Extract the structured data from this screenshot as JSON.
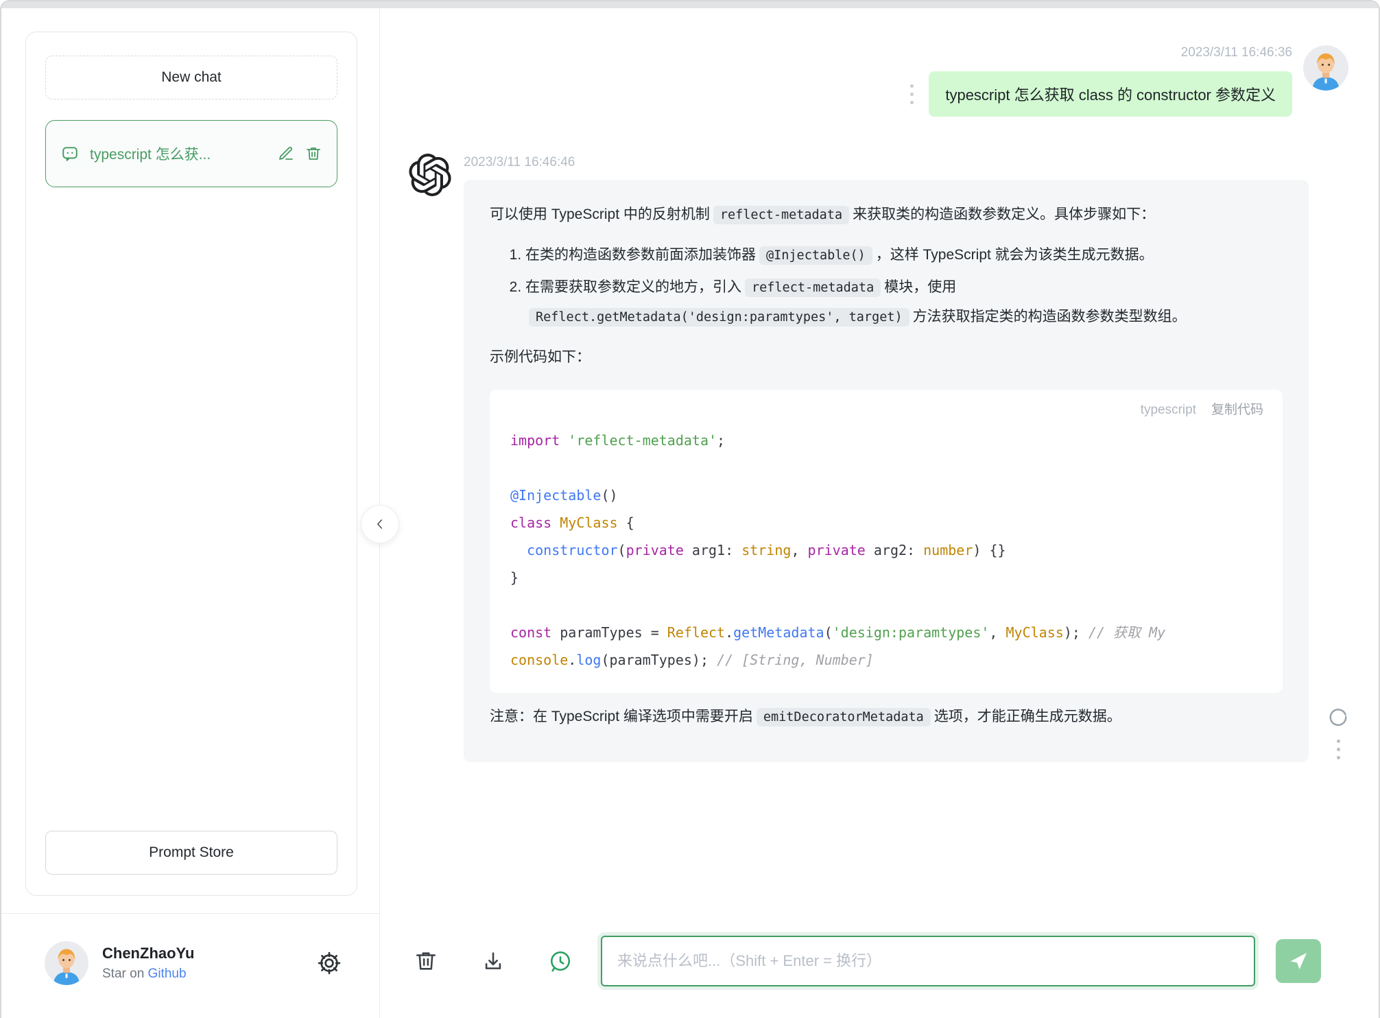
{
  "sidebar": {
    "new_chat_label": "New chat",
    "conversation": {
      "title": "typescript 怎么获..."
    },
    "prompt_store_label": "Prompt Store",
    "user": {
      "name": "ChenZhaoYu",
      "star_prefix": "Star on ",
      "github_label": "Github"
    }
  },
  "chat": {
    "user_message": {
      "timestamp": "2023/3/11 16:46:36",
      "text": "typescript 怎么获取 class 的 constructor 参数定义"
    },
    "assistant_message": {
      "timestamp": "2023/3/11 16:46:46",
      "intro": [
        {
          "t": "可以使用 TypeScript 中的反射机制"
        },
        {
          "t": "reflect-metadata",
          "code": true
        },
        {
          "t": "来获取类的构造函数参数定义。具体步骤如下："
        }
      ],
      "steps": [
        [
          {
            "t": "在类的构造函数参数前面添加装饰器"
          },
          {
            "t": "@Injectable()",
            "code": true
          },
          {
            "t": "，这样 TypeScript 就会为该类生成元数据。"
          }
        ],
        [
          {
            "t": "在需要获取参数定义的地方，引入"
          },
          {
            "t": "reflect-metadata",
            "code": true
          },
          {
            "t": "模块，使用"
          },
          {
            "t": "Reflect.getMetadata('design:paramtypes', target)",
            "code": true
          },
          {
            "t": "方法获取指定类的构造函数参数类型数组。"
          }
        ]
      ],
      "example_label": "示例代码如下：",
      "note": [
        {
          "t": "注意：在 TypeScript 编译选项中需要开启"
        },
        {
          "t": "emitDecoratorMetadata",
          "code": true
        },
        {
          "t": "选项，才能正确生成元数据。"
        }
      ]
    },
    "code_block": {
      "language": "typescript",
      "copy_label": "复制代码",
      "lines": [
        [
          {
            "t": "import",
            "c": "kw"
          },
          {
            "t": " "
          },
          {
            "t": "'reflect-metadata'",
            "c": "str"
          },
          {
            "t": ";"
          }
        ],
        [],
        [
          {
            "t": "@Injectable",
            "c": "meta"
          },
          {
            "t": "()"
          }
        ],
        [
          {
            "t": "class",
            "c": "kw"
          },
          {
            "t": " "
          },
          {
            "t": "MyClass",
            "c": "type"
          },
          {
            "t": " {"
          }
        ],
        [
          {
            "t": "  "
          },
          {
            "t": "constructor",
            "c": "fn"
          },
          {
            "t": "("
          },
          {
            "t": "private",
            "c": "kw"
          },
          {
            "t": " arg1: "
          },
          {
            "t": "string",
            "c": "type"
          },
          {
            "t": ", "
          },
          {
            "t": "private",
            "c": "kw"
          },
          {
            "t": " arg2: "
          },
          {
            "t": "number",
            "c": "type"
          },
          {
            "t": ") {}"
          }
        ],
        [
          {
            "t": "}"
          }
        ],
        [],
        [
          {
            "t": "const",
            "c": "kw"
          },
          {
            "t": " paramTypes = "
          },
          {
            "t": "Reflect",
            "c": "type"
          },
          {
            "t": "."
          },
          {
            "t": "getMetadata",
            "c": "fn"
          },
          {
            "t": "("
          },
          {
            "t": "'design:paramtypes'",
            "c": "str"
          },
          {
            "t": ", "
          },
          {
            "t": "MyClass",
            "c": "type"
          },
          {
            "t": "); "
          },
          {
            "t": "// 获取 My",
            "c": "cmt"
          }
        ],
        [
          {
            "t": "console",
            "c": "type"
          },
          {
            "t": "."
          },
          {
            "t": "log",
            "c": "fn"
          },
          {
            "t": "("
          },
          {
            "t": "paramTypes); "
          },
          {
            "t": "// [String, Number]",
            "c": "cmt"
          }
        ]
      ]
    }
  },
  "composer": {
    "placeholder": "来说点什么吧...（Shift + Enter = 换行）"
  },
  "icons": {
    "sidebar_item": "chat-bubble-icon",
    "edit": "pencil-icon",
    "delete": "trash-icon",
    "settings": "gear-icon",
    "clear": "trash-icon",
    "export": "download-icon",
    "history": "chat-history-icon",
    "send": "paper-plane-icon",
    "regenerate": "refresh-icon",
    "collapse": "chevron-left-icon",
    "assistant": "openai-logo"
  },
  "colors": {
    "accent_green": "#3f9e63",
    "user_bubble": "#d2f9d1",
    "assistant_bubble": "#f4f6f8",
    "send_button_bg": "#8fd0a2",
    "timestamp": "#b4bbc4",
    "link_blue": "#4b83f0",
    "code_keyword": "#a626a4",
    "code_string": "#50a14f",
    "code_builtin": "#c18401",
    "code_function": "#4078f2",
    "code_comment": "#a0a1a7"
  }
}
